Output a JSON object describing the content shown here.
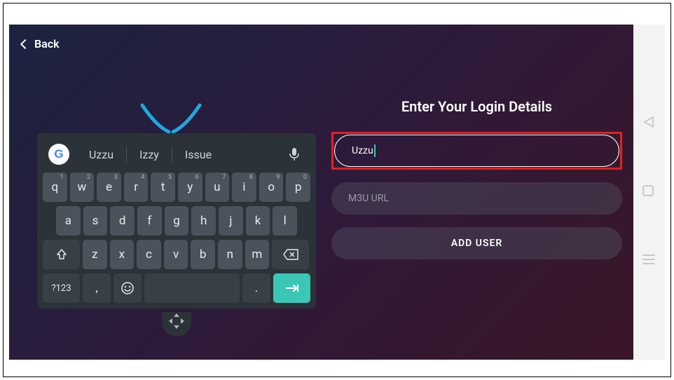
{
  "back_label": "Back",
  "suggestions": [
    "Uzzu",
    "Izzy",
    "Issue"
  ],
  "keyboard": {
    "row1": [
      {
        "k": "q",
        "n": "1"
      },
      {
        "k": "w",
        "n": "2"
      },
      {
        "k": "e",
        "n": "3"
      },
      {
        "k": "r",
        "n": "4"
      },
      {
        "k": "t",
        "n": "5"
      },
      {
        "k": "y",
        "n": "6"
      },
      {
        "k": "u",
        "n": "7"
      },
      {
        "k": "i",
        "n": "8"
      },
      {
        "k": "o",
        "n": "9"
      },
      {
        "k": "p",
        "n": "0"
      }
    ],
    "row2": [
      "a",
      "s",
      "d",
      "f",
      "g",
      "h",
      "j",
      "k",
      "l"
    ],
    "row3": [
      "z",
      "x",
      "c",
      "v",
      "b",
      "n",
      "m"
    ],
    "symbols_key": "?123",
    "comma_key": ",",
    "period_key": "."
  },
  "form": {
    "title": "Enter Your Login Details",
    "username_value": "Uzzu",
    "url_placeholder": "M3U URL",
    "submit_label": "ADD USER"
  }
}
